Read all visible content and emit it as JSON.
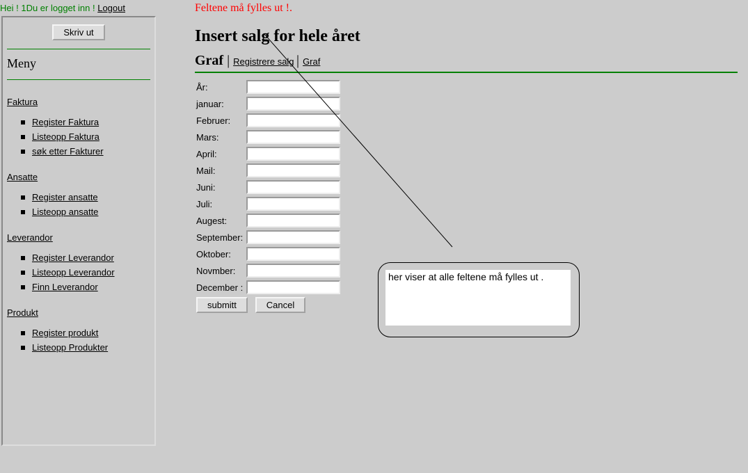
{
  "topbar": {
    "hei": "Hei ! 1",
    "logged": "Du er logget inn !",
    "logout": "Logout"
  },
  "sidebar": {
    "print_label": "Skriv ut",
    "menu_title": "Meny",
    "sections": [
      {
        "title": "Faktura",
        "items": [
          "Register Faktura",
          "Listeopp Faktura",
          "søk etter Fakturer"
        ]
      },
      {
        "title": "Ansatte",
        "items": [
          "Register ansatte",
          "Listeopp ansatte"
        ]
      },
      {
        "title": "Leverandor",
        "items": [
          "Register Leverandor",
          "Listeopp Leverandor",
          "Finn Leverandor"
        ]
      },
      {
        "title": "Produkt",
        "items": [
          "Register produkt",
          "Listeopp Produkter"
        ]
      }
    ]
  },
  "main": {
    "error": "Feltene må fylles ut !.",
    "heading": "Insert salg for hele året",
    "subhead_label": "Graf",
    "link_registrere": "Registrere salg",
    "link_graf": "Graf",
    "fields": [
      "År:",
      "januar:",
      "Februer:",
      "Mars:",
      "April:",
      "Mail:",
      "Juni:",
      "Juli:",
      "Augest:",
      "September:",
      "Oktober:",
      "Novmber:",
      "December :"
    ],
    "values": [
      "",
      "",
      "",
      "",
      "",
      "",
      "",
      "",
      "",
      "",
      "",
      "",
      ""
    ],
    "submit_label": "submitt",
    "cancel_label": "Cancel"
  },
  "callout": {
    "text": "her viser at alle feltene må fylles ut ."
  }
}
